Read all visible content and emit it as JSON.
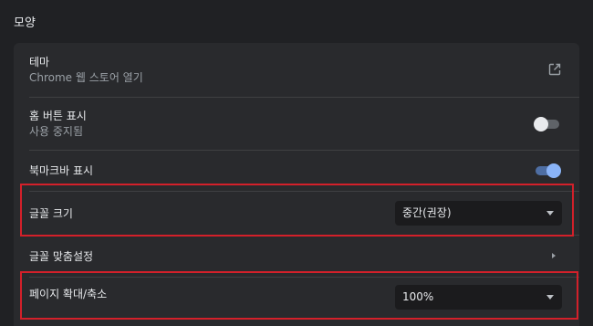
{
  "section": {
    "title": "모양"
  },
  "theme": {
    "label": "테마",
    "sublabel": "Chrome 웹 스토어 열기",
    "icon": "open-in-new-icon"
  },
  "home_button": {
    "label": "홈 버튼 표시",
    "sublabel": "사용 중지됨",
    "enabled": false
  },
  "bookmark_bar": {
    "label": "북마크바 표시",
    "enabled": true
  },
  "font_size": {
    "label": "글꼴 크기",
    "value": "중간(권장)"
  },
  "custom_fonts": {
    "label": "글꼴 맞춤설정"
  },
  "page_zoom": {
    "label": "페이지 확대/축소",
    "value": "100%"
  },
  "colors": {
    "accent": "#8ab4f8",
    "highlight_border": "#d3202a"
  }
}
